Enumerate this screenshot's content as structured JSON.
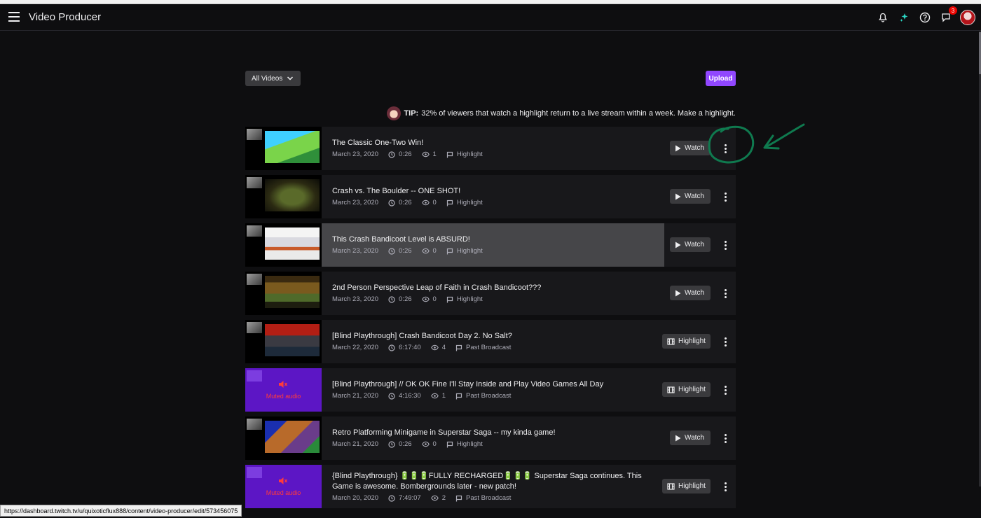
{
  "app": {
    "title": "Video Producer",
    "notification_count": "3"
  },
  "toolbar": {
    "filter_label": "All Videos",
    "upload_label": "Upload"
  },
  "tip": {
    "label": "TIP:",
    "text": "32% of viewers that watch a highlight return to a live stream within a week. Make a highlight."
  },
  "videos": [
    {
      "title": "The Classic One-Two Win!",
      "date": "March 23, 2020",
      "duration": "0:26",
      "views": "1",
      "type": "Highlight",
      "action": "Watch"
    },
    {
      "title": "Crash vs. The Boulder -- ONE SHOT!",
      "date": "March 23, 2020",
      "duration": "0:26",
      "views": "0",
      "type": "Highlight",
      "action": "Watch"
    },
    {
      "title": "This Crash Bandicoot Level is ABSURD!",
      "date": "March 23, 2020",
      "duration": "0:26",
      "views": "0",
      "type": "Highlight",
      "action": "Watch"
    },
    {
      "title": "2nd Person Perspective Leap of Faith in Crash Bandicoot???",
      "date": "March 23, 2020",
      "duration": "0:26",
      "views": "0",
      "type": "Highlight",
      "action": "Watch"
    },
    {
      "title": "[Blind Playthrough] Crash Bandicoot Day 2. No Salt?",
      "date": "March 22, 2020",
      "duration": "6:17:40",
      "views": "4",
      "type": "Past Broadcast",
      "action": "Highlight"
    },
    {
      "title": "[Blind Playthrough] // OK OK Fine I'll Stay Inside and Play Video Games All Day",
      "date": "March 21, 2020",
      "duration": "4:16:30",
      "views": "1",
      "type": "Past Broadcast",
      "action": "Highlight",
      "thumb_label": "Muted audio"
    },
    {
      "title": "Retro Platforming Minigame in Superstar Saga -- my kinda game!",
      "date": "March 21, 2020",
      "duration": "0:26",
      "views": "0",
      "type": "Highlight",
      "action": "Watch"
    },
    {
      "title": "{Blind Playthrough} 🔋🔋🔋FULLY RECHARGED🔋🔋🔋 Superstar Saga continues. This Game is awesome. Bombergrounds later - new patch!",
      "date": "March 20, 2020",
      "duration": "7:49:07",
      "views": "2",
      "type": "Past Broadcast",
      "action": "Highlight",
      "thumb_label": "Muted audio"
    }
  ],
  "status_url": "https://dashboard.twitch.tv/u/quixoticflux888/content/video-producer/edit/573456075",
  "colors": {
    "accent": "#9147ff",
    "background": "#0e0e10",
    "row": "#18181b",
    "row_hover": "#464649",
    "annotation": "#0f7a4f",
    "muted": "#5c16c5"
  },
  "icons": [
    "hamburger-icon",
    "bell-icon",
    "sparkle-icon",
    "help-icon",
    "whispers-icon",
    "chevron-down-icon",
    "clock-icon",
    "eye-icon",
    "flag-icon",
    "play-icon",
    "film-icon",
    "more-vertical-icon",
    "muted-speaker-icon"
  ]
}
